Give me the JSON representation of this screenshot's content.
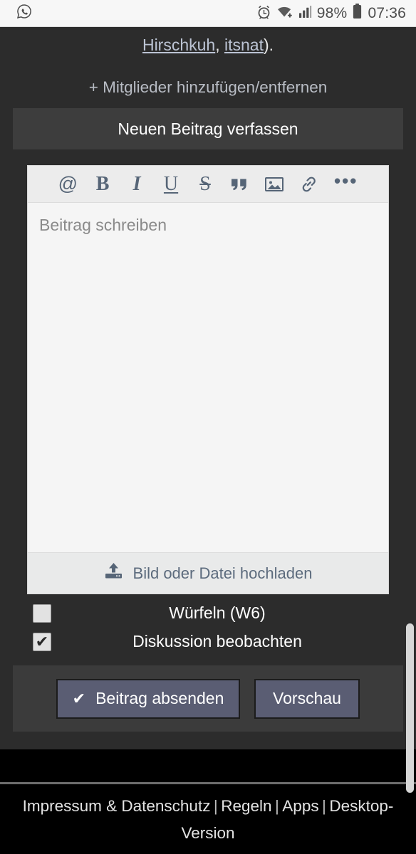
{
  "statusbar": {
    "app_icon": "whatsapp-icon",
    "alarm_icon": "alarm-clock-icon",
    "wifi_icon": "wifi-icon",
    "signal_icon": "cellular-signal-icon",
    "battery_percent": "98%",
    "battery_icon": "battery-full-icon",
    "time": "07:36"
  },
  "content": {
    "snippet_link": "Hirschkuh",
    "snippet_comma": ", ",
    "snippet_link2": "itsnat",
    "snippet_tail": ").",
    "add_members": "+ Mitglieder hinzufügen/entfernen",
    "new_post_header": "Neuen Beitrag verfassen"
  },
  "editor": {
    "toolbar": [
      {
        "name": "mention-icon",
        "glyph": "@"
      },
      {
        "name": "bold-icon",
        "glyph": "B"
      },
      {
        "name": "italic-icon",
        "glyph": "I"
      },
      {
        "name": "underline-icon",
        "glyph": "U"
      },
      {
        "name": "strikethrough-icon",
        "glyph": "S"
      },
      {
        "name": "quote-icon",
        "glyph": "”"
      },
      {
        "name": "image-icon",
        "glyph": "image"
      },
      {
        "name": "link-icon",
        "glyph": "link"
      },
      {
        "name": "more-options-icon",
        "glyph": "•••"
      }
    ],
    "placeholder": "Beitrag schreiben",
    "textarea_value": "",
    "upload_label": "Bild oder Datei hochladen",
    "upload_icon": "upload-icon"
  },
  "options": [
    {
      "label": "Würfeln (W6)",
      "checked": false,
      "mark": ""
    },
    {
      "label": "Diskussion beobachten",
      "checked": true,
      "mark": "✔"
    }
  ],
  "actions": {
    "submit_label": "Beitrag absenden",
    "submit_icon": "✔",
    "preview_label": "Vorschau"
  },
  "footer": {
    "link1": "Impressum & Datenschutz",
    "sep1": "|",
    "link2": "Regeln",
    "sep2": "|",
    "link3": "Apps",
    "sep3": "|",
    "link4": "Desktop-Version"
  },
  "colors": {
    "page_background": "#2c2c2c",
    "editor_background": "#f5f5f5",
    "toolbar_background": "#ececec",
    "button_accent": "#5a5d73",
    "toolbar_icon": "#566577"
  }
}
